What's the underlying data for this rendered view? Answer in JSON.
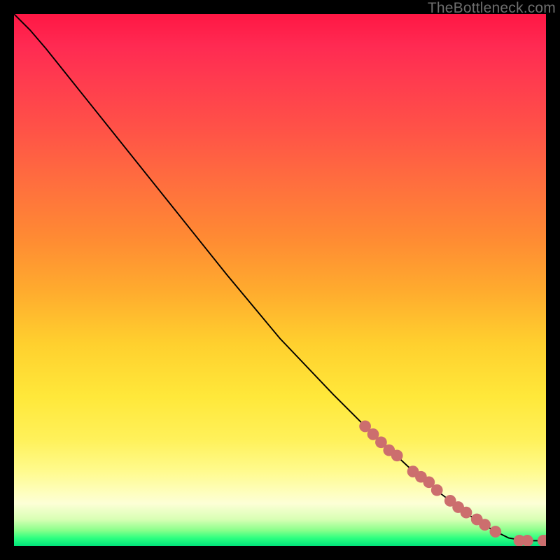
{
  "source_label": "TheBottleneck.com",
  "chart_data": {
    "type": "line",
    "title": "",
    "xlabel": "",
    "ylabel": "",
    "xlim": [
      0,
      100
    ],
    "ylim": [
      0,
      100
    ],
    "grid": false,
    "legend": false,
    "curve": {
      "name": "bottleneck-curve",
      "color": "#000000",
      "points": [
        {
          "x": 0.0,
          "y": 100.0
        },
        {
          "x": 3.0,
          "y": 97.0
        },
        {
          "x": 6.0,
          "y": 93.5
        },
        {
          "x": 10.0,
          "y": 88.5
        },
        {
          "x": 20.0,
          "y": 76.0
        },
        {
          "x": 30.0,
          "y": 63.5
        },
        {
          "x": 40.0,
          "y": 51.0
        },
        {
          "x": 50.0,
          "y": 39.0
        },
        {
          "x": 60.0,
          "y": 28.5
        },
        {
          "x": 66.0,
          "y": 22.5
        },
        {
          "x": 74.0,
          "y": 15.0
        },
        {
          "x": 80.0,
          "y": 10.0
        },
        {
          "x": 86.0,
          "y": 5.5
        },
        {
          "x": 90.0,
          "y": 3.0
        },
        {
          "x": 93.0,
          "y": 1.5
        },
        {
          "x": 96.0,
          "y": 1.0
        },
        {
          "x": 100.0,
          "y": 1.0
        }
      ]
    },
    "markers": {
      "name": "highlighted-points",
      "color": "#cc6e6e",
      "radius": 1.1,
      "points": [
        {
          "x": 66.0,
          "y": 22.5
        },
        {
          "x": 67.5,
          "y": 21.0
        },
        {
          "x": 69.0,
          "y": 19.5
        },
        {
          "x": 70.5,
          "y": 18.0
        },
        {
          "x": 72.0,
          "y": 17.0
        },
        {
          "x": 75.0,
          "y": 14.0
        },
        {
          "x": 76.5,
          "y": 13.0
        },
        {
          "x": 78.0,
          "y": 12.0
        },
        {
          "x": 79.5,
          "y": 10.5
        },
        {
          "x": 82.0,
          "y": 8.5
        },
        {
          "x": 83.5,
          "y": 7.3
        },
        {
          "x": 85.0,
          "y": 6.3
        },
        {
          "x": 87.0,
          "y": 5.0
        },
        {
          "x": 88.5,
          "y": 4.0
        },
        {
          "x": 90.5,
          "y": 2.7
        },
        {
          "x": 95.0,
          "y": 1.0
        },
        {
          "x": 96.5,
          "y": 1.0
        },
        {
          "x": 99.5,
          "y": 1.0
        },
        {
          "x": 100.0,
          "y": 1.0
        }
      ]
    }
  }
}
